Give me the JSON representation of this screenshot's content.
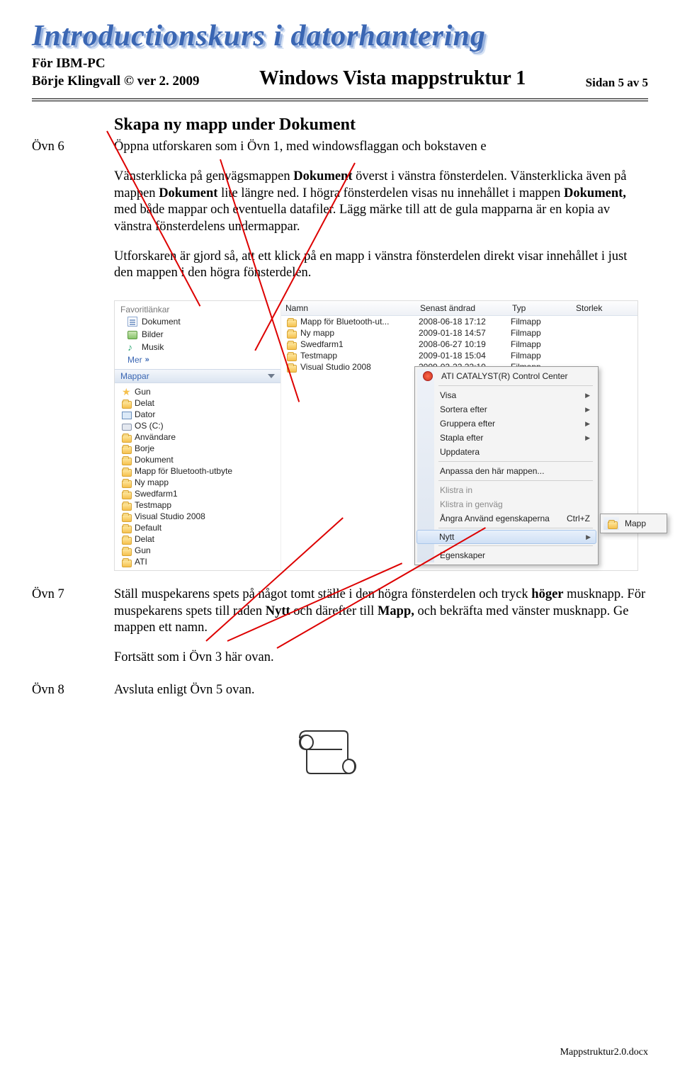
{
  "title_art": "Introductionskurs i datorhantering",
  "header": {
    "left_top": "För IBM-PC",
    "left_bottom": "Börje Klingvall © ver 2.  2009",
    "center": "Windows Vista mappstruktur 1",
    "right": "Sidan 5 av 5"
  },
  "section_title": "Skapa ny mapp under Dokument",
  "ovn6": {
    "label": "Övn 6",
    "p1": "Öppna utforskaren som i Övn 1, med windowsflaggan och bokstaven e",
    "p2_pre": "Vänsterklicka på genvägsmappen ",
    "p2_b1": "Dokument",
    "p2_mid": " överst i vänstra fönsterdelen. Vänsterklicka även på mappen ",
    "p2_b2": "Dokument",
    "p2_post1": " lite längre ned. I högra fönsterdelen visas nu innehållet i mappen ",
    "p2_b3": "Dokument,",
    "p2_post2": " med både mappar och eventuella datafiler. Lägg märke till att de gula mapparna är en kopia av vänstra fönsterdelens undermappar.",
    "p3": "Utforskaren är gjord så, att ett klick på en mapp i vänstra fönsterdelen direkt visar innehållet i just den mappen i den högra fönsterdelen."
  },
  "explorer": {
    "favorites_header": "Favoritlänkar",
    "fav_items": [
      {
        "icon": "doc",
        "label": "Dokument"
      },
      {
        "icon": "pic",
        "label": "Bilder"
      },
      {
        "icon": "music",
        "label": "Musik"
      }
    ],
    "mer": "Mer",
    "mappar_header": "Mappar",
    "tree": [
      {
        "indent": 0,
        "icon": "star",
        "label": "Gun"
      },
      {
        "indent": 0,
        "icon": "folder",
        "label": "Delat"
      },
      {
        "indent": 0,
        "icon": "comp",
        "label": "Dator"
      },
      {
        "indent": 1,
        "icon": "drive",
        "label": "OS (C:)"
      },
      {
        "indent": 2,
        "icon": "folder",
        "label": "Användare"
      },
      {
        "indent": 3,
        "icon": "folder",
        "label": "Borje"
      },
      {
        "indent": 4,
        "icon": "folder",
        "label": "Dokument"
      },
      {
        "indent": 5,
        "icon": "folder",
        "label": "Mapp för Bluetooth-utbyte"
      },
      {
        "indent": 5,
        "icon": "folder",
        "label": "Ny mapp"
      },
      {
        "indent": 5,
        "icon": "folder",
        "label": "Swedfarm1"
      },
      {
        "indent": 5,
        "icon": "folder",
        "label": "Testmapp"
      },
      {
        "indent": 5,
        "icon": "folder",
        "label": "Visual Studio 2008"
      },
      {
        "indent": 3,
        "icon": "folder",
        "label": "Default"
      },
      {
        "indent": 3,
        "icon": "folder",
        "label": "Delat"
      },
      {
        "indent": 3,
        "icon": "folder",
        "label": "Gun"
      },
      {
        "indent": 2,
        "icon": "folder",
        "label": "ATI"
      }
    ],
    "columns": {
      "name": "Namn",
      "date": "Senast ändrad",
      "type": "Typ",
      "size": "Storlek"
    },
    "files": [
      {
        "name": "Mapp för Bluetooth-ut...",
        "date": "2008-06-18 17:12",
        "type": "Filmapp"
      },
      {
        "name": "Ny mapp",
        "date": "2009-01-18 14:57",
        "type": "Filmapp"
      },
      {
        "name": "Swedfarm1",
        "date": "2008-06-27 10:19",
        "type": "Filmapp"
      },
      {
        "name": "Testmapp",
        "date": "2009-01-18 15:04",
        "type": "Filmapp"
      },
      {
        "name": "Visual Studio 2008",
        "date": "2009-02-22 22:10",
        "type": "Filmapp"
      }
    ],
    "ctx": {
      "title_icon_label": "ATI CATALYST(R) Control Center",
      "items": [
        {
          "label": "Visa",
          "arrow": true
        },
        {
          "label": "Sortera efter",
          "arrow": true
        },
        {
          "label": "Gruppera efter",
          "arrow": true
        },
        {
          "label": "Stapla efter",
          "arrow": true
        },
        {
          "label": "Uppdatera"
        }
      ],
      "anpassa": "Anpassa den här mappen...",
      "klistra": "Klistra in",
      "klistra_genvag": "Klistra in genväg",
      "undo": {
        "label": "Ångra Använd egenskaperna",
        "key": "Ctrl+Z"
      },
      "nytt": {
        "label": "Nytt",
        "arrow": true,
        "selected": true
      },
      "egenskaper": "Egenskaper",
      "submenu_item": "Mapp"
    }
  },
  "ovn7": {
    "label": "Övn 7",
    "p1_pre": "Ställ muspekarens spets på något tomt ställe i den högra fönsterdelen och tryck ",
    "p1_b1": "höger",
    "p1_mid1": " musknapp. För muspekarens spets till raden ",
    "p1_b2": "Nytt",
    "p1_mid2": " och därefter till ",
    "p1_b3": "Mapp,",
    "p1_post": " och bekräfta med vänster musknapp. Ge mappen ett namn.",
    "p2": "Fortsätt som i Övn 3 här ovan."
  },
  "ovn8": {
    "label": "Övn 8",
    "text": "Avsluta enligt Övn 5 ovan."
  },
  "footer_file": "Mappstruktur2.0.docx"
}
